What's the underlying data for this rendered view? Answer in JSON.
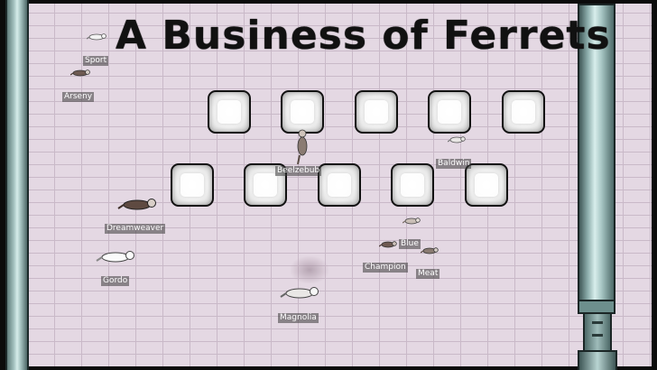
{
  "title": "A Business of Ferrets",
  "ferrets": [
    {
      "name": "Sport"
    },
    {
      "name": "Arseny"
    },
    {
      "name": "Beelzebub"
    },
    {
      "name": "Baldwin"
    },
    {
      "name": "Dreamweaver"
    },
    {
      "name": "Gordo"
    },
    {
      "name": "Blue"
    },
    {
      "name": "Champion"
    },
    {
      "name": "Meat"
    },
    {
      "name": "Magnolia"
    }
  ],
  "colors": {
    "wall": "#e4d8e3",
    "mortar": "#c9b9c8",
    "pipe": "#a8c4c2",
    "border": "#0b0b0b"
  },
  "pillow_count": 10
}
